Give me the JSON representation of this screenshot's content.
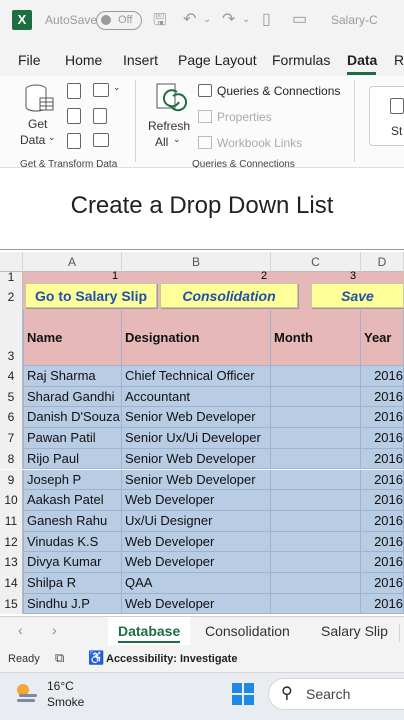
{
  "titlebar": {
    "autosave": "AutoSave",
    "toggle_state": "Off",
    "filename": "Salary-C"
  },
  "menu": {
    "file": "File",
    "home": "Home",
    "insert": "Insert",
    "page_layout": "Page Layout",
    "formulas": "Formulas",
    "data": "Data",
    "more": "Re"
  },
  "ribbon": {
    "get_data_1": "Get",
    "get_data_2": "Data",
    "group1": "Get & Transform Data",
    "refresh_1": "Refresh",
    "refresh_2": "All",
    "queries": "Queries & Connections",
    "properties": "Properties",
    "workbook_links": "Workbook Links",
    "group2": "Queries & Connections",
    "stocks": "St"
  },
  "caption": "Create a Drop Down List",
  "grid": {
    "columns": [
      "A",
      "B",
      "C",
      "D"
    ],
    "row1_numbers": [
      "1",
      "2",
      "3"
    ],
    "buttons": {
      "salary_slip": "Go to Salary Slip",
      "consolidation": "Consolidation",
      "save": "Save"
    },
    "headers": {
      "name": "Name",
      "designation": "Designation",
      "month": "Month",
      "year": "Year"
    },
    "rows": [
      {
        "num": "1"
      },
      {
        "num": "2"
      },
      {
        "num": "3"
      },
      {
        "num": "4",
        "name": "Raj Sharma",
        "designation": "Chief Technical Officer",
        "year": "2016"
      },
      {
        "num": "5",
        "name": "Sharad Gandhi",
        "designation": "Accountant",
        "year": "2016"
      },
      {
        "num": "6",
        "name": "Danish D'Souza",
        "designation": "Senior Web Developer",
        "year": "2016"
      },
      {
        "num": "7",
        "name": "Pawan Patil",
        "designation": "Senior Ux/Ui Developer",
        "year": "2016"
      },
      {
        "num": "8",
        "name": "Rijo Paul",
        "designation": "Senior Web Developer",
        "year": "2016"
      },
      {
        "num": "9",
        "name": "Joseph P",
        "designation": "Senior Web Developer",
        "year": "2016"
      },
      {
        "num": "10",
        "name": "Aakash Patel",
        "designation": "Web Developer",
        "year": "2016"
      },
      {
        "num": "11",
        "name": "Ganesh Rahu",
        "designation": "Ux/Ui Designer",
        "year": "2016"
      },
      {
        "num": "12",
        "name": "Vinudas K.S",
        "designation": "Web Developer",
        "year": "2016"
      },
      {
        "num": "13",
        "name": "Divya Kumar",
        "designation": "Web Developer",
        "year": "2016"
      },
      {
        "num": "14",
        "name": "Shilpa R",
        "designation": "QAA",
        "year": "2016"
      },
      {
        "num": "15",
        "name": "Sindhu J.P",
        "designation": "Web Developer",
        "year": "2016"
      }
    ]
  },
  "sheets": [
    "Database",
    "Consolidation",
    "Salary Slip"
  ],
  "status": {
    "ready": "Ready",
    "accessibility": "Accessibility: Investigate"
  },
  "taskbar": {
    "temp": "16°C",
    "weather": "Smoke",
    "search": "Search"
  },
  "colors": {
    "excel_green": "#1d6f42",
    "header_pink": "#e6b9b8",
    "row_blue": "#b8cce4",
    "button_yellow": "#ffff99"
  }
}
